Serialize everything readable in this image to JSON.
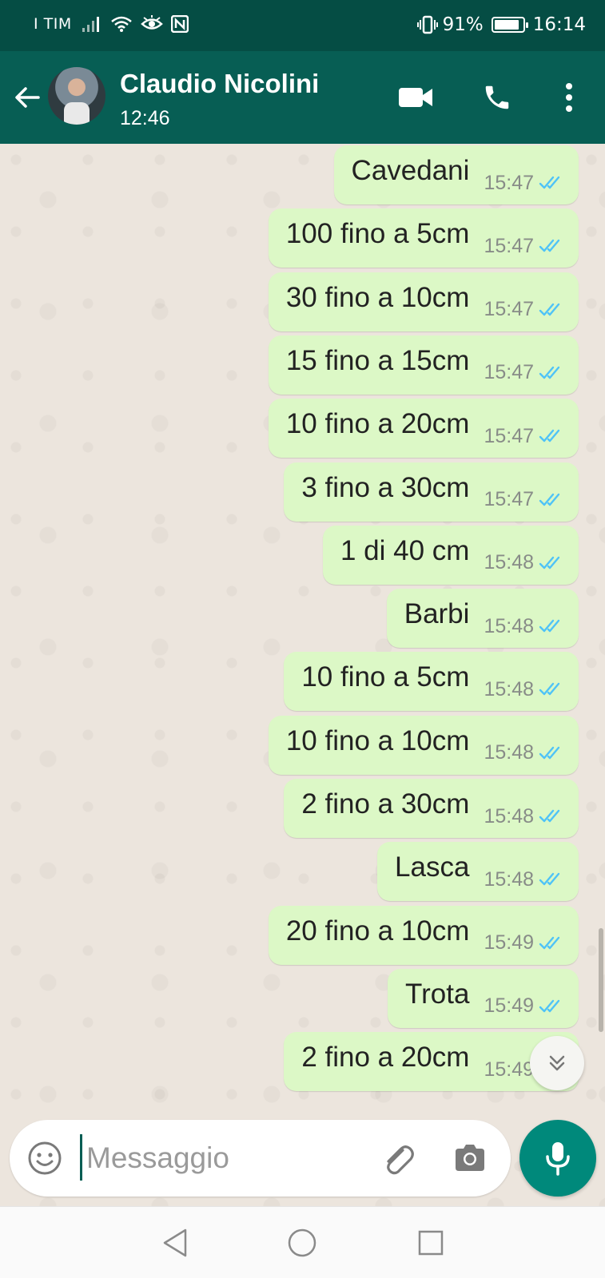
{
  "status_bar": {
    "carrier": "I TIM",
    "battery_percent": "91%",
    "battery_level": 0.91,
    "time": "16:14",
    "icons": [
      "signal-icon",
      "wifi-icon",
      "eye-icon",
      "nfc-icon",
      "vibrate-icon",
      "battery-icon"
    ]
  },
  "header": {
    "contact_name": "Claudio Nicolini",
    "contact_status": "12:46",
    "icons": [
      "back-arrow-icon",
      "video-call-icon",
      "phone-icon",
      "more-vert-icon"
    ]
  },
  "messages": [
    {
      "text": "Cavedani",
      "time": "15:47"
    },
    {
      "text": "100 fino a 5cm",
      "time": "15:47"
    },
    {
      "text": "30 fino a 10cm",
      "time": "15:47"
    },
    {
      "text": "15 fino a 15cm",
      "time": "15:47"
    },
    {
      "text": "10 fino a 20cm",
      "time": "15:47"
    },
    {
      "text": "3 fino a 30cm",
      "time": "15:47"
    },
    {
      "text": "1 di 40 cm",
      "time": "15:48"
    },
    {
      "text": "Barbi",
      "time": "15:48"
    },
    {
      "text": "10 fino a 5cm",
      "time": "15:48"
    },
    {
      "text": "10 fino a 10cm",
      "time": "15:48"
    },
    {
      "text": "2 fino a 30cm",
      "time": "15:48"
    },
    {
      "text": "Lasca",
      "time": "15:48"
    },
    {
      "text": "20 fino a 10cm",
      "time": "15:49"
    },
    {
      "text": "Trota",
      "time": "15:49"
    },
    {
      "text": "2 fino a 20cm",
      "time": "15:49"
    }
  ],
  "composer": {
    "placeholder": "Messaggio",
    "value": ""
  },
  "colors": {
    "status_bar": "#054d44",
    "header": "#075e54",
    "outgoing_bubble": "#dcf8c6",
    "read_ticks": "#4fc3f7",
    "mic_button": "#00897b"
  }
}
